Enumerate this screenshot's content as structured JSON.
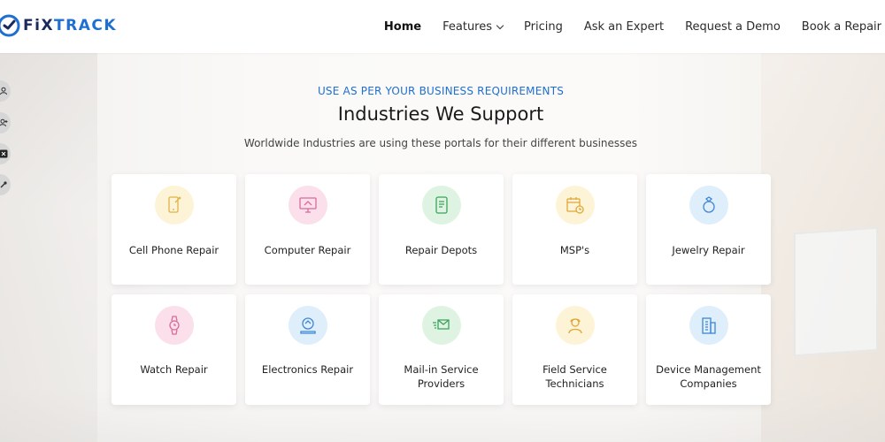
{
  "brand": {
    "part1": "FiX",
    "part2": "TRACK",
    "primary": "#1a2a5c",
    "accent": "#1f6fd1"
  },
  "nav": [
    {
      "label": "Home",
      "active": true
    },
    {
      "label": "Features",
      "dropdown": true
    },
    {
      "label": "Pricing"
    },
    {
      "label": "Ask an Expert"
    },
    {
      "label": "Request a Demo"
    },
    {
      "label": "Book a Repair"
    }
  ],
  "social_icons": [
    "user-icon",
    "user-plus-icon",
    "x-twitter-icon",
    "tools-icon"
  ],
  "section": {
    "eyebrow": "USE AS PER YOUR BUSINESS REQUIREMENTS",
    "title": "Industries We Support",
    "subtitle": "Worldwide Industries are using these portals for their different businesses"
  },
  "industries": [
    {
      "label": "Cell Phone Repair",
      "icon": "phone-repair-icon",
      "color": "#fdf3d6"
    },
    {
      "label": "Computer Repair",
      "icon": "computer-repair-icon",
      "color": "#fbe0ec"
    },
    {
      "label": "Repair Depots",
      "icon": "repair-depot-icon",
      "color": "#dff3e3"
    },
    {
      "label": "MSP's",
      "icon": "calendar-clock-icon",
      "color": "#fdf3d6"
    },
    {
      "label": "Jewelry Repair",
      "icon": "jewelry-icon",
      "color": "#dfeefb"
    },
    {
      "label": "Watch Repair",
      "icon": "watch-icon",
      "color": "#fbe0ec"
    },
    {
      "label": "Electronics Repair",
      "icon": "electronics-icon",
      "color": "#dfeefb"
    },
    {
      "label": "Mail-in Service Providers",
      "icon": "mail-in-icon",
      "color": "#dff3e3"
    },
    {
      "label": "Field Service Technicians",
      "icon": "technician-icon",
      "color": "#fdf3d6"
    },
    {
      "label": "Device Management Companies",
      "icon": "building-icon",
      "color": "#dfeefb"
    }
  ]
}
